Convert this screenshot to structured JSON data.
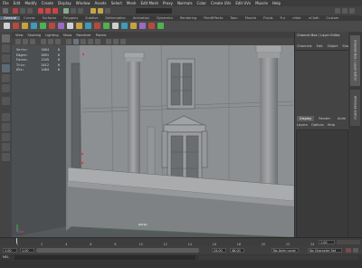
{
  "menubar": {
    "items": [
      "File",
      "Edit",
      "Modify",
      "Create",
      "Display",
      "Window",
      "Assets",
      "Select",
      "Mesh",
      "Edit Mesh",
      "Proxy",
      "Normals",
      "Color",
      "Create UVs",
      "Edit UVs",
      "Muscle",
      "Help"
    ]
  },
  "shelf": {
    "tabs": [
      "General",
      "Curves",
      "Surfaces",
      "Polygons",
      "Subdivs",
      "Deformation",
      "Animation",
      "Dynamics",
      "Rendering",
      "PaintEffects",
      "Toon",
      "Muscle",
      "Fluids",
      "Fur",
      "nHair",
      "nCloth",
      "Custom"
    ],
    "active_tab": "General"
  },
  "viewport": {
    "menu": [
      "View",
      "Shading",
      "Lighting",
      "Show",
      "Renderer",
      "Panels"
    ],
    "hud": [
      {
        "label": "Verts:",
        "value": "1664",
        "selected": "0"
      },
      {
        "label": "Edges:",
        "value": "2891",
        "selected": "0"
      },
      {
        "label": "Faces:",
        "value": "1245",
        "selected": "0"
      },
      {
        "label": "Tris:",
        "value": "2412",
        "selected": "0"
      },
      {
        "label": "UVs:",
        "value": "1484",
        "selected": "0"
      }
    ],
    "camera_label": "persp"
  },
  "channel_box": {
    "title": "Channel Box / Layer Editor",
    "menu": [
      "Channels",
      "Edit",
      "Object",
      "Show"
    ],
    "layer_tabs": [
      "Display",
      "Render",
      "Anim"
    ],
    "layer_menu": [
      "Layers",
      "Options",
      "Help"
    ]
  },
  "side_tabs": [
    "Channel Box / Layer Editor",
    "Attribute Editor"
  ],
  "timeline": {
    "ticks": [
      "1",
      "2",
      "4",
      "6",
      "8",
      "10",
      "12",
      "14",
      "16",
      "18",
      "20",
      "22",
      "24"
    ],
    "current_frame": "1.00"
  },
  "range": {
    "start": "1.00",
    "start_inner": "1.00",
    "end_inner": "24.00",
    "end": "48.00",
    "anim_layer": "No Anim Layer",
    "char_set": "No Character Set"
  },
  "command": {
    "label": "MEL"
  },
  "colors": {
    "accent": "#5b6b7a",
    "building": "#8a8d90",
    "column": "#9a9c9e",
    "sky": "#5e6266"
  }
}
